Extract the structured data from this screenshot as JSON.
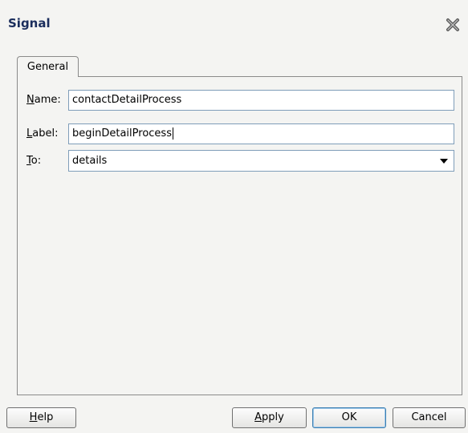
{
  "dialog": {
    "title": "Signal",
    "close_icon": "close-icon"
  },
  "tabs": [
    {
      "label": "General"
    }
  ],
  "form": {
    "name": {
      "mnemonic": "N",
      "rest": "ame:",
      "value": "contactDetailProcess"
    },
    "label": {
      "mnemonic": "L",
      "rest": "abel:",
      "value": "beginDetailProcess"
    },
    "to": {
      "mnemonic": "T",
      "rest": "o:",
      "value": "details"
    }
  },
  "buttons": {
    "help": {
      "mnemonic": "H",
      "rest": "elp"
    },
    "apply": {
      "mnemonic": "A",
      "rest": "pply"
    },
    "ok": "OK",
    "cancel": "Cancel"
  }
}
